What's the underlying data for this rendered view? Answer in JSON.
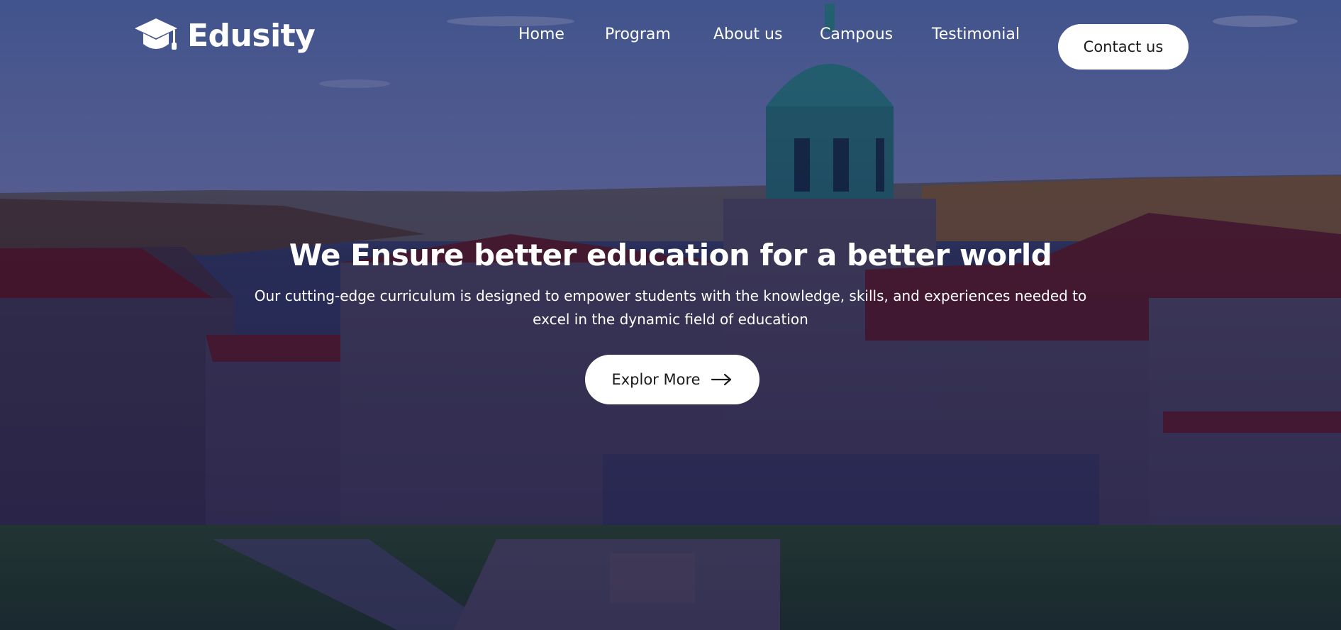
{
  "brand": {
    "name": "Edusity",
    "icon": "graduation-cap-icon"
  },
  "nav": {
    "items": [
      {
        "label": "Home"
      },
      {
        "label": "Program"
      },
      {
        "label": "About us"
      },
      {
        "label": "Campous"
      },
      {
        "label": "Testimonial"
      }
    ],
    "contact_label": "Contact us"
  },
  "hero": {
    "title": "We Ensure better education for a better world",
    "subtitle": "Our cutting-edge curriculum is designed to empower students with the knowledge, skills, and experiences needed to excel in the dynamic field of education",
    "cta_label": "Explor More",
    "cta_icon": "arrow-right-icon",
    "background": "university-campus-aerial-photo"
  },
  "colors": {
    "overlay": "#08003a",
    "button_bg": "#ffffff",
    "button_text": "#1b1b1b",
    "text": "#ffffff"
  }
}
